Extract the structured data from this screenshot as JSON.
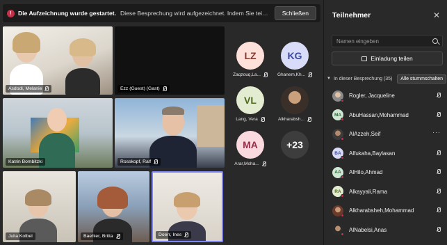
{
  "banner": {
    "title": "Die Aufzeichnung wurde gestartet.",
    "message": "Diese Besprechung wird aufgezeichnet. Indem Sie teilnehmen...",
    "close_label": "Schließen"
  },
  "tiles": [
    {
      "name": "Asdodi, Melanie"
    },
    {
      "name": "Ezz (Guest) (Gast)"
    },
    {
      "name": "Katrin Bombitzki"
    },
    {
      "name": "Rosskopf, Ralf"
    },
    {
      "name": "Julia Kolbel"
    },
    {
      "name": "Baehler, Britta"
    },
    {
      "name": "Doerr, Ines"
    }
  ],
  "avatars": [
    {
      "initials": "LZ",
      "name": "Zaqzouq,La..."
    },
    {
      "initials": "KG",
      "name": "Ghanem,Kh..."
    },
    {
      "initials": "VL",
      "name": "Lang, Vera"
    },
    {
      "initials": "",
      "name": "Alkharabsh..."
    },
    {
      "initials": "MA",
      "name": "Arar,Moha..."
    },
    {
      "initials": "+23",
      "name": ""
    }
  ],
  "panel": {
    "title": "Teilnehmer",
    "search_placeholder": "Namen eingeben",
    "invite_label": "Einladung teilen",
    "section_label": "In dieser Besprechung (35)",
    "mute_all_label": "Alle stummschalten",
    "participants": [
      {
        "initials": "",
        "name": "Rogler, Jacqueline",
        "status": "muted"
      },
      {
        "initials": "MA",
        "name": "AbuHassan,Mohammad",
        "status": "muted"
      },
      {
        "initials": "",
        "name": "AlAzzeh,Seif",
        "status": "more"
      },
      {
        "initials": "BA",
        "name": "Alfukaha,Baylasan",
        "status": "muted"
      },
      {
        "initials": "AA",
        "name": "AlHilo,Ahmad",
        "status": "muted"
      },
      {
        "initials": "RA",
        "name": "Alkayyali,Rama",
        "status": "muted"
      },
      {
        "initials": "",
        "name": "Alkharabsheh,Mohammad",
        "status": "muted"
      },
      {
        "initials": "",
        "name": "AlNabelsi,Anas",
        "status": "muted"
      }
    ]
  },
  "colors": {
    "background": "#292929",
    "accent": "#7f85f5",
    "alert": "#c4314b"
  }
}
